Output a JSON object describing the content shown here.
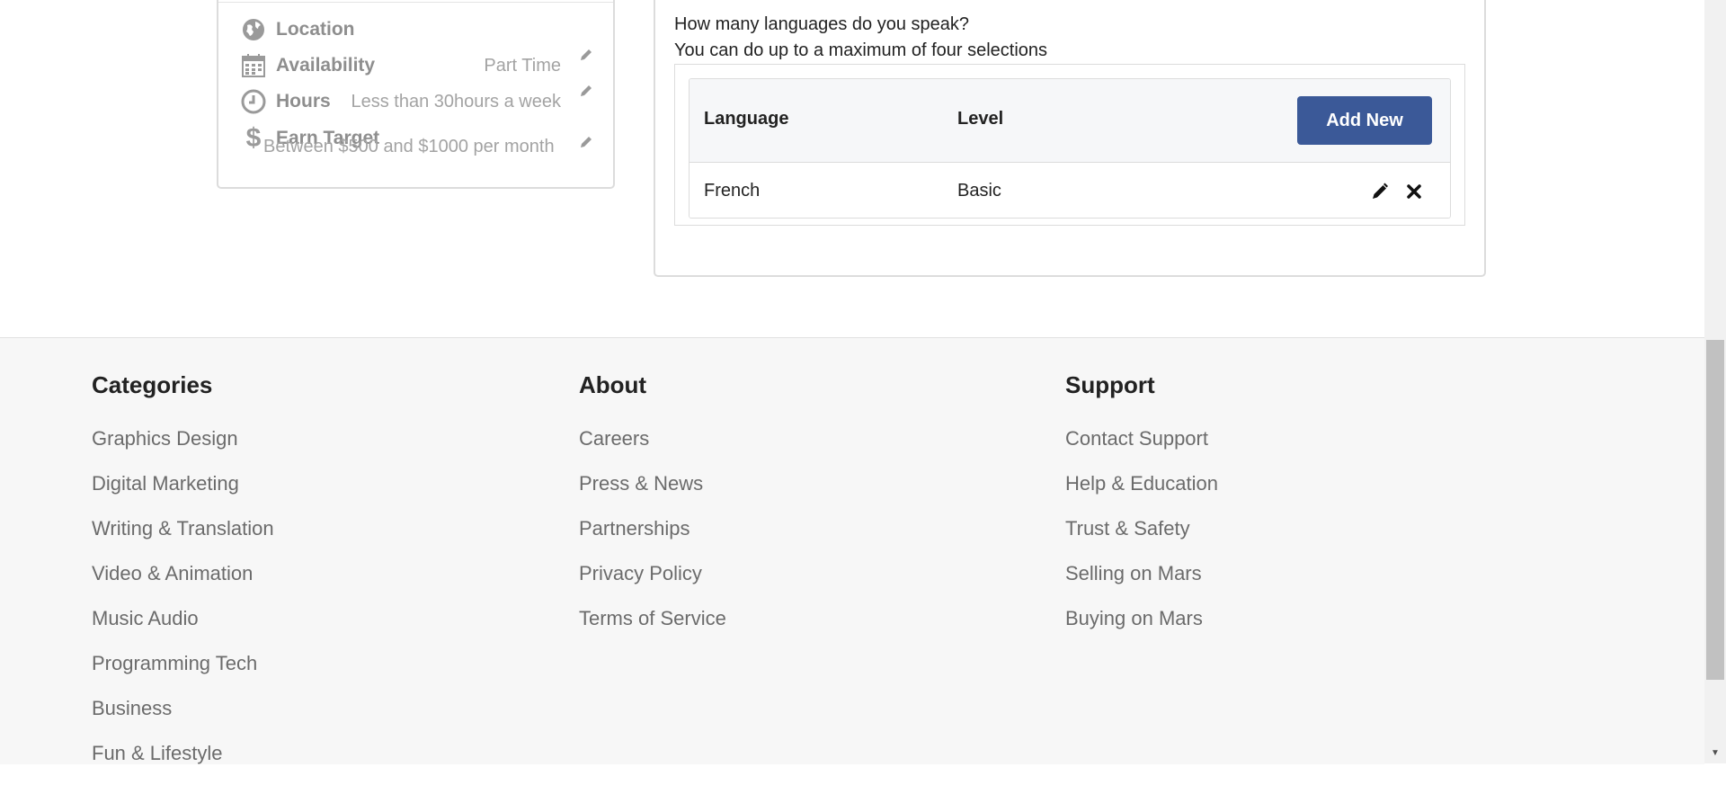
{
  "profile": {
    "location_label": "Location",
    "availability_label": "Availability",
    "availability_value": "Part Time",
    "hours_label": "Hours",
    "hours_value": "Less than 30hours a week",
    "earn_label": "Earn Target",
    "earn_value": "Between $500 and $1000 per month"
  },
  "languages": {
    "question": "How many languages do you speak?",
    "note": "You can do up to a maximum of four selections",
    "col_language": "Language",
    "col_level": "Level",
    "add_label": "Add New",
    "rows": [
      {
        "language": "French",
        "level": "Basic"
      }
    ]
  },
  "footer": {
    "categories": {
      "title": "Categories",
      "links": [
        "Graphics Design",
        "Digital Marketing",
        "Writing & Translation",
        "Video & Animation",
        "Music Audio",
        "Programming Tech",
        "Business",
        "Fun & Lifestyle"
      ]
    },
    "about": {
      "title": "About",
      "links": [
        "Careers",
        "Press & News",
        "Partnerships",
        "Privacy Policy",
        "Terms of Service"
      ]
    },
    "support": {
      "title": "Support",
      "links": [
        "Contact Support",
        "Help & Education",
        "Trust & Safety",
        "Selling on Mars",
        "Buying on Mars"
      ]
    }
  },
  "colors": {
    "accent": "#3b5998",
    "footer_bg": "#f7f7f7"
  }
}
